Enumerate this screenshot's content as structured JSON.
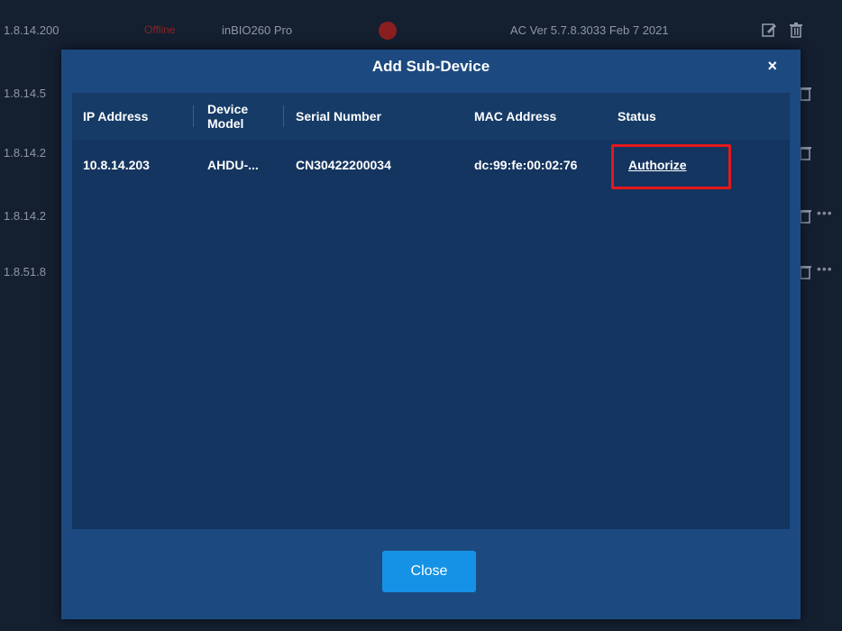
{
  "background_rows": [
    {
      "ip": "1.8.14.200",
      "status": "Offline",
      "model": "inBIO260 Pro",
      "version": "AC Ver 5.7.8.3033 Feb 7 2021"
    },
    {
      "ip": "1.8.14.5"
    },
    {
      "ip": "1.8.14.2"
    },
    {
      "ip": "1.8.14.2"
    },
    {
      "ip": "1.8.51.8"
    }
  ],
  "modal": {
    "title": "Add Sub-Device",
    "close_icon": "×",
    "columns": [
      "IP Address",
      "Device Model",
      "Serial Number",
      "MAC Address",
      "Status"
    ],
    "rows": [
      {
        "ip": "10.8.14.203",
        "model": "AHDU-...",
        "serial": "CN30422200034",
        "mac": "dc:99:fe:00:02:76",
        "status": "Authorize"
      }
    ],
    "close_button": "Close"
  },
  "colors": {
    "modal_bg": "#1c4a80",
    "table_bg": "#14355f",
    "button": "#1592e6",
    "highlight": "#e3191b"
  },
  "icons": [
    "edit-icon",
    "trash-icon",
    "close-icon",
    "more-icon",
    "offline-dot-icon"
  ]
}
